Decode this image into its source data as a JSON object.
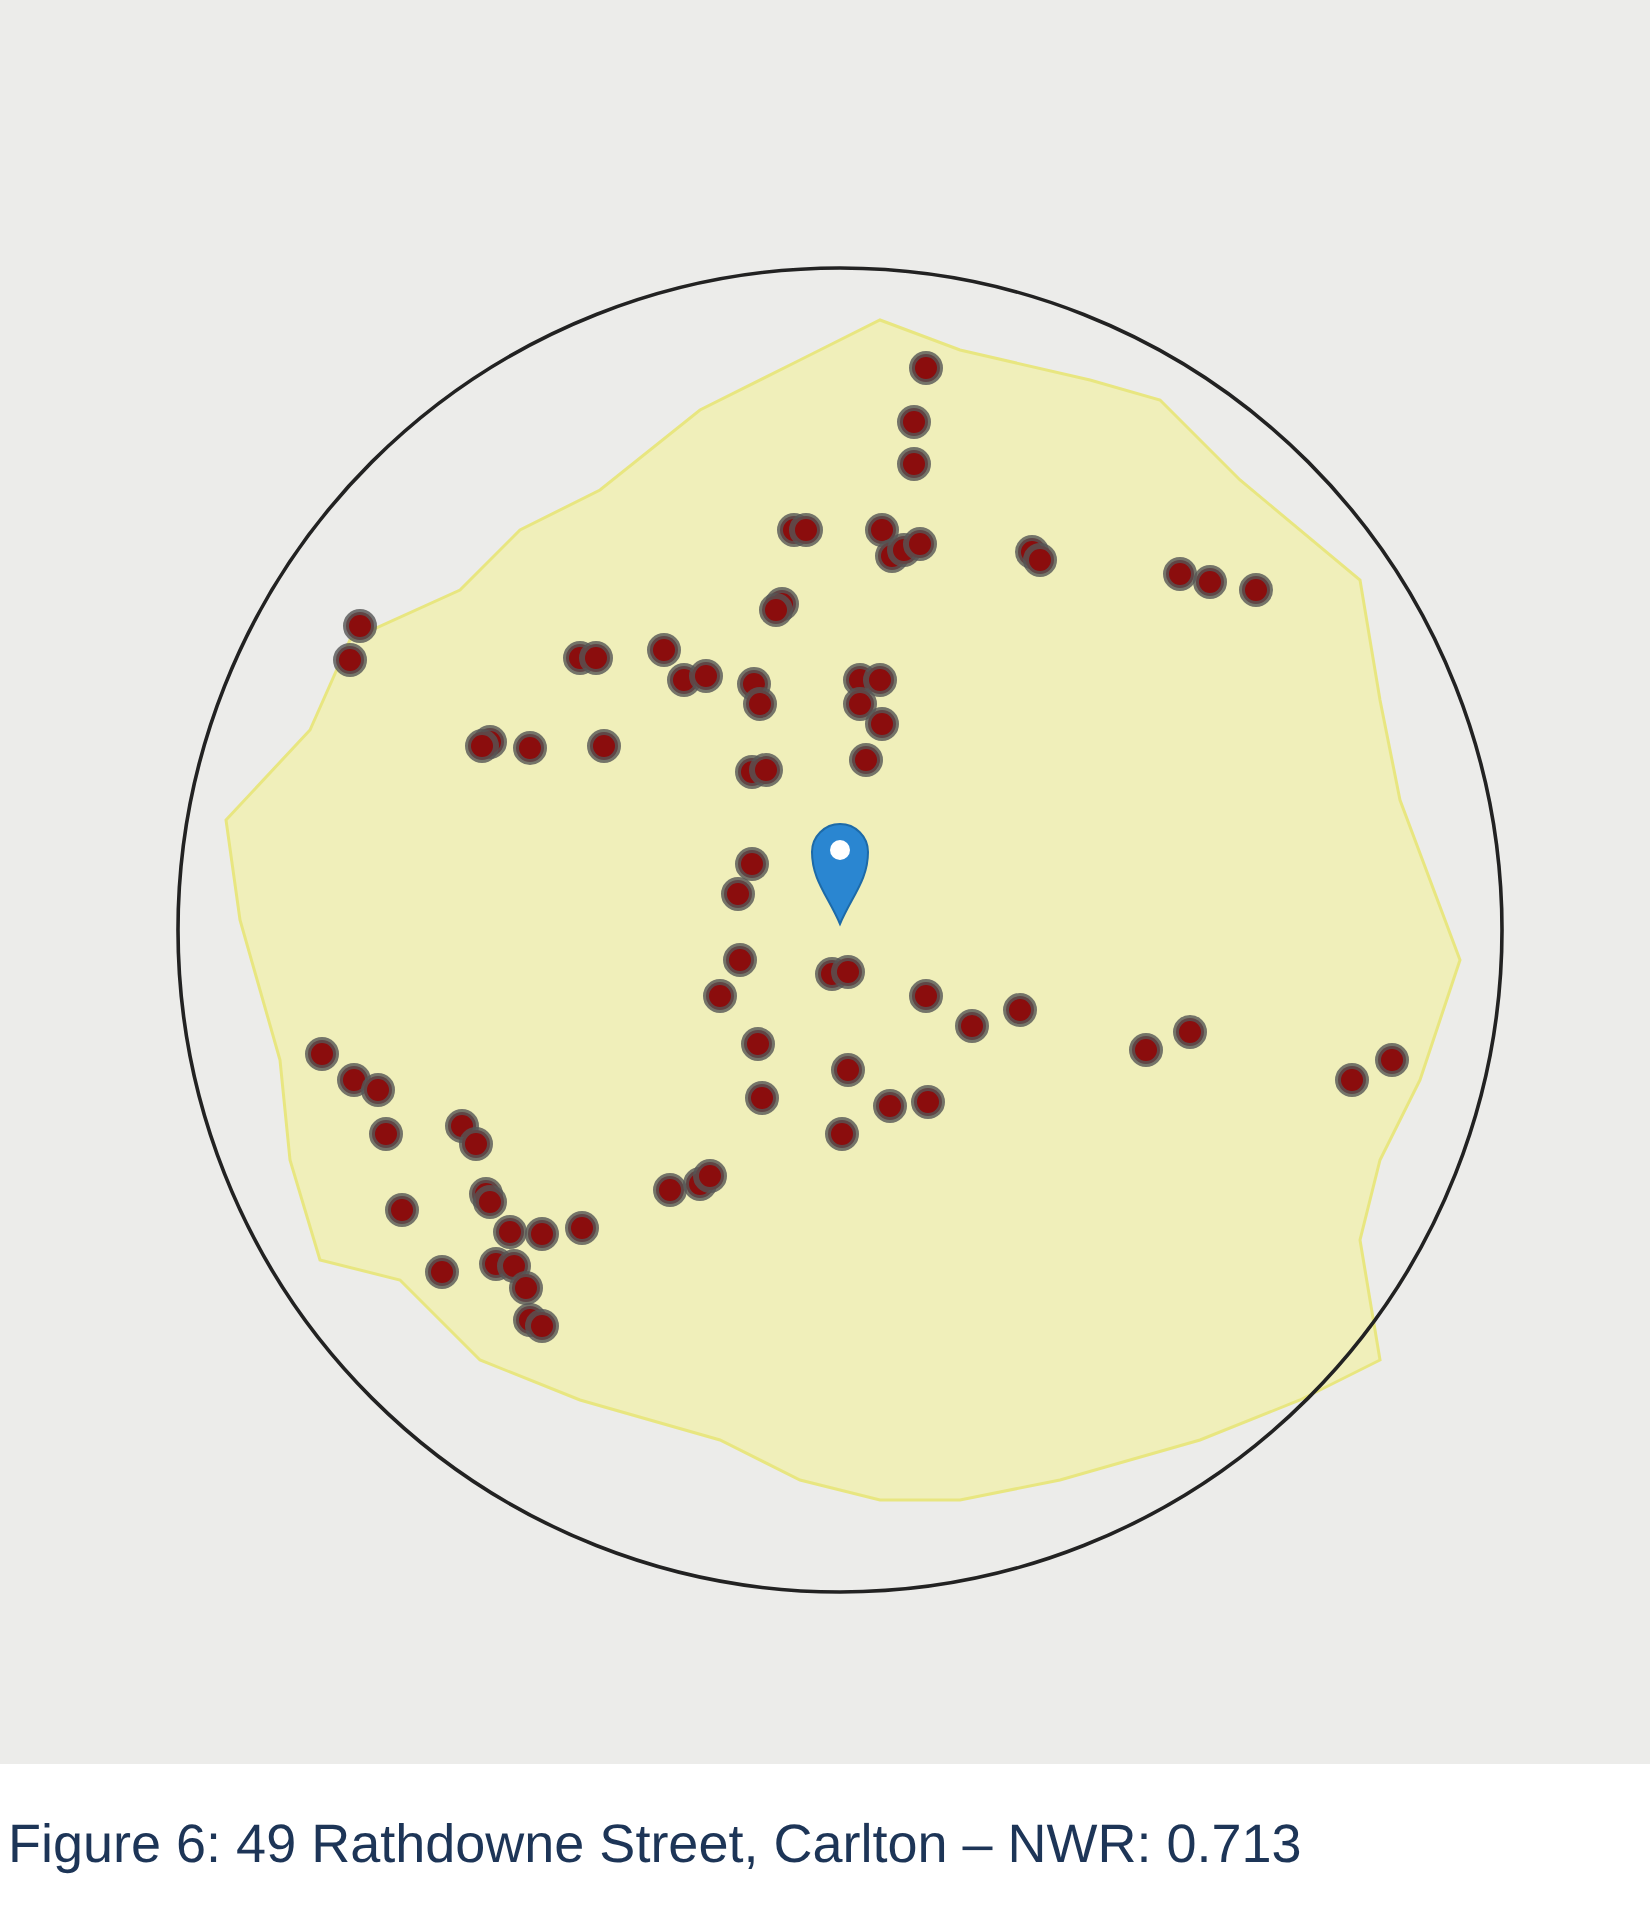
{
  "figure": {
    "caption": "Figure 6: 49 Rathdowne Street, Carlton – NWR: 0.713"
  }
}
